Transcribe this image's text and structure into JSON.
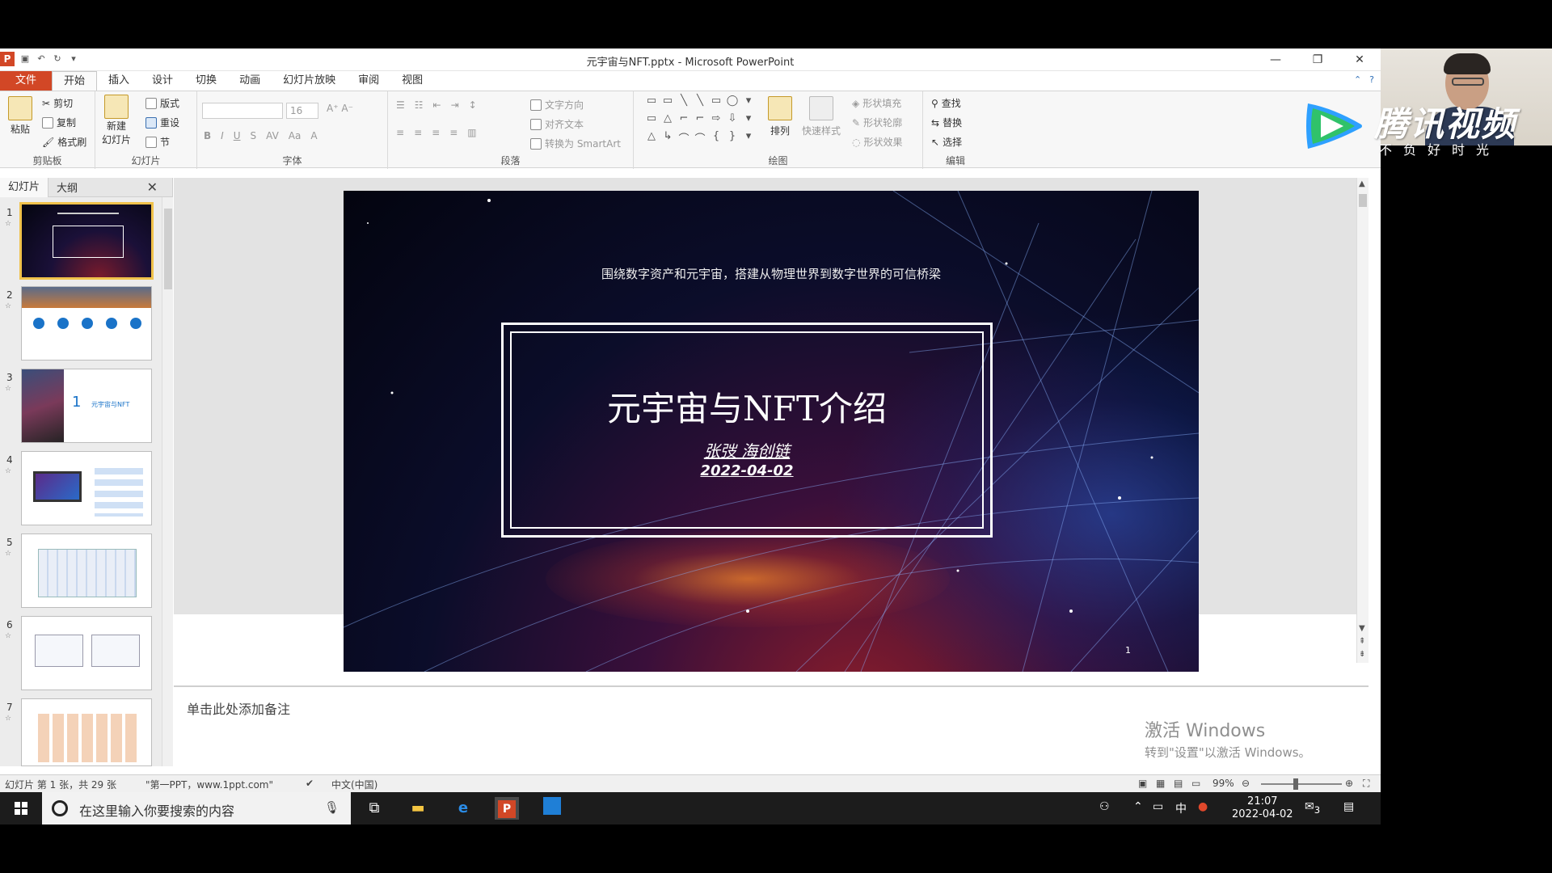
{
  "window": {
    "title": "元宇宙与NFT.pptx - Microsoft PowerPoint",
    "controls": [
      "—",
      "❐",
      "✕"
    ]
  },
  "ribbon_tabs": [
    "文件",
    "开始",
    "插入",
    "设计",
    "切换",
    "动画",
    "幻灯片放映",
    "审阅",
    "视图"
  ],
  "ribbon": {
    "clipboard": {
      "label": "剪贴板",
      "paste": "粘贴",
      "cut": "剪切",
      "copy": "复制",
      "format_painter": "格式刷"
    },
    "slides": {
      "label": "幻灯片",
      "new_slide_line1": "新建",
      "new_slide_line2": "幻灯片",
      "layout": "版式",
      "reset": "重设",
      "section": "节"
    },
    "font": {
      "label": "字体",
      "size": "16"
    },
    "paragraph": {
      "label": "段落",
      "text_direction": "文字方向",
      "align_text": "对齐文本",
      "smartart": "转换为 SmartArt"
    },
    "drawing": {
      "label": "绘图",
      "arrange": "排列",
      "quick_styles": "快速样式",
      "shape_fill": "形状填充",
      "shape_outline": "形状轮廓",
      "shape_effects": "形状效果"
    },
    "editing": {
      "label": "编辑",
      "find": "查找",
      "replace": "替换",
      "select": "选择"
    }
  },
  "pane": {
    "tab_slides": "幻灯片",
    "tab_outline": "大纲",
    "thumbnails": [
      {
        "num": "1"
      },
      {
        "num": "2"
      },
      {
        "num": "3"
      },
      {
        "num": "4"
      },
      {
        "num": "5"
      },
      {
        "num": "6"
      },
      {
        "num": "7"
      }
    ],
    "thumb3_text": "元宇宙与NFT",
    "thumb3_num": "1"
  },
  "slide": {
    "subtitle": "围绕数字资产和元宇宙，搭建从物理世界到数字世界的可信桥梁",
    "title": "元宇宙与NFT介绍",
    "author": "张弢 海创链",
    "date": "2022-04-02",
    "page_number": "1"
  },
  "notes_placeholder": "单击此处添加备注",
  "activation": {
    "line1": "激活 Windows",
    "line2": "转到\"设置\"以激活 Windows。"
  },
  "status": {
    "slide_info": "幻灯片 第 1 张，共 29 张",
    "theme": "\"第一PPT，www.1ppt.com\"",
    "language": "中文(中国)",
    "zoom": "99%"
  },
  "taskbar": {
    "search_placeholder": "在这里输入你要搜索的内容",
    "time": "21:07",
    "date": "2022-04-02",
    "ime": "中",
    "notifications": "3"
  },
  "overlay": {
    "brand": "腾讯视频",
    "slogan": "不负好时光"
  },
  "colors": {
    "file_tab": "#d24726",
    "accent": "#2f6fb7"
  }
}
